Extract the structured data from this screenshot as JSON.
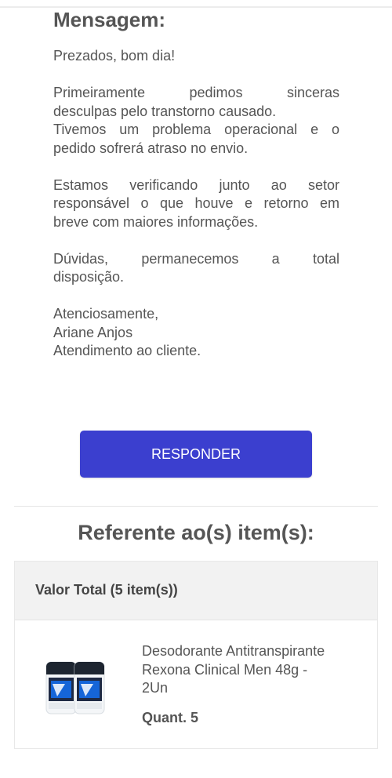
{
  "message": {
    "heading": "Mensagem:",
    "greeting": "Prezados, bom dia!",
    "paragraph1": [
      "Primeiramente pedimos sinceras",
      "desculpas pelo transtorno causado.",
      "Tivemos um problema operacional e o",
      "pedido sofrerá atraso no envio."
    ],
    "paragraph2": [
      "Estamos verificando junto ao setor",
      "responsável o que houve e retorno em",
      "breve com maiores informações."
    ],
    "paragraph3": [
      "Dúvidas, permanecemos a total",
      "disposição."
    ],
    "signature": [
      "Atenciosamente,",
      "Ariane Anjos",
      "Atendimento ao cliente."
    ]
  },
  "reply_button": {
    "label": "RESPONDER",
    "color": "#3b3fcf"
  },
  "items": {
    "heading": "Referente ao(s) item(s):",
    "total_label": "Valor Total (5 item(s))",
    "products": [
      {
        "name_lines": [
          "Desodorante Antitranspirante",
          "Rexona Clinical Men 48g -",
          "2Un"
        ],
        "quantity": "Quant. 5",
        "image_icon": "deodorant-product-icon"
      }
    ]
  }
}
